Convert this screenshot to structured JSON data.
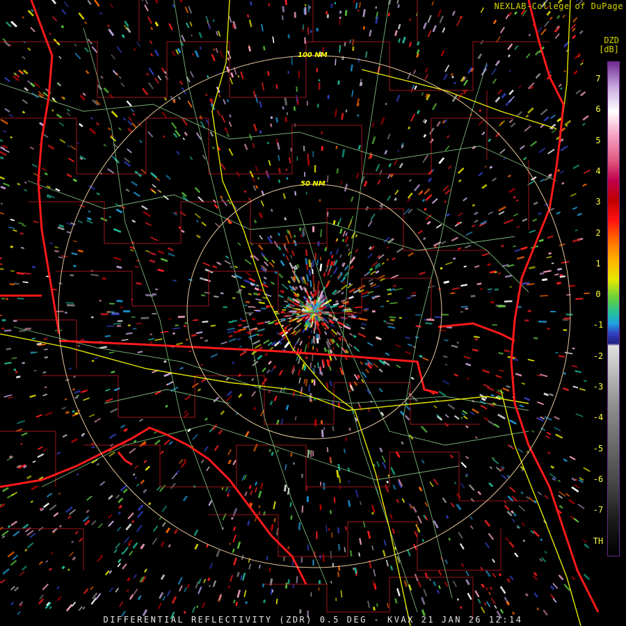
{
  "credit": "NEXLAB-College of DuPage",
  "colorbar": {
    "product_code": "DZD",
    "unit": "[dB]",
    "labels": [
      "7",
      "6",
      "5",
      "4",
      "3",
      "2",
      "1",
      "0",
      "-1",
      "-2",
      "-3",
      "-4",
      "-5",
      "-6",
      "-7",
      "TH"
    ],
    "range": [
      -7,
      7
    ]
  },
  "range_rings": [
    {
      "label": "100 NM"
    },
    {
      "label": "50 NM"
    }
  ],
  "caption": "DIFFERENTIAL REFLECTIVITY (ZDR) 0.5 DEG - KVAX 21 JAN 26 12:14",
  "colors": {
    "state_border": "#ff1a1a",
    "county_border": "#a0141a",
    "highway": "#e8e800",
    "road": "#8fd88f",
    "ring": "#e8c89a"
  }
}
